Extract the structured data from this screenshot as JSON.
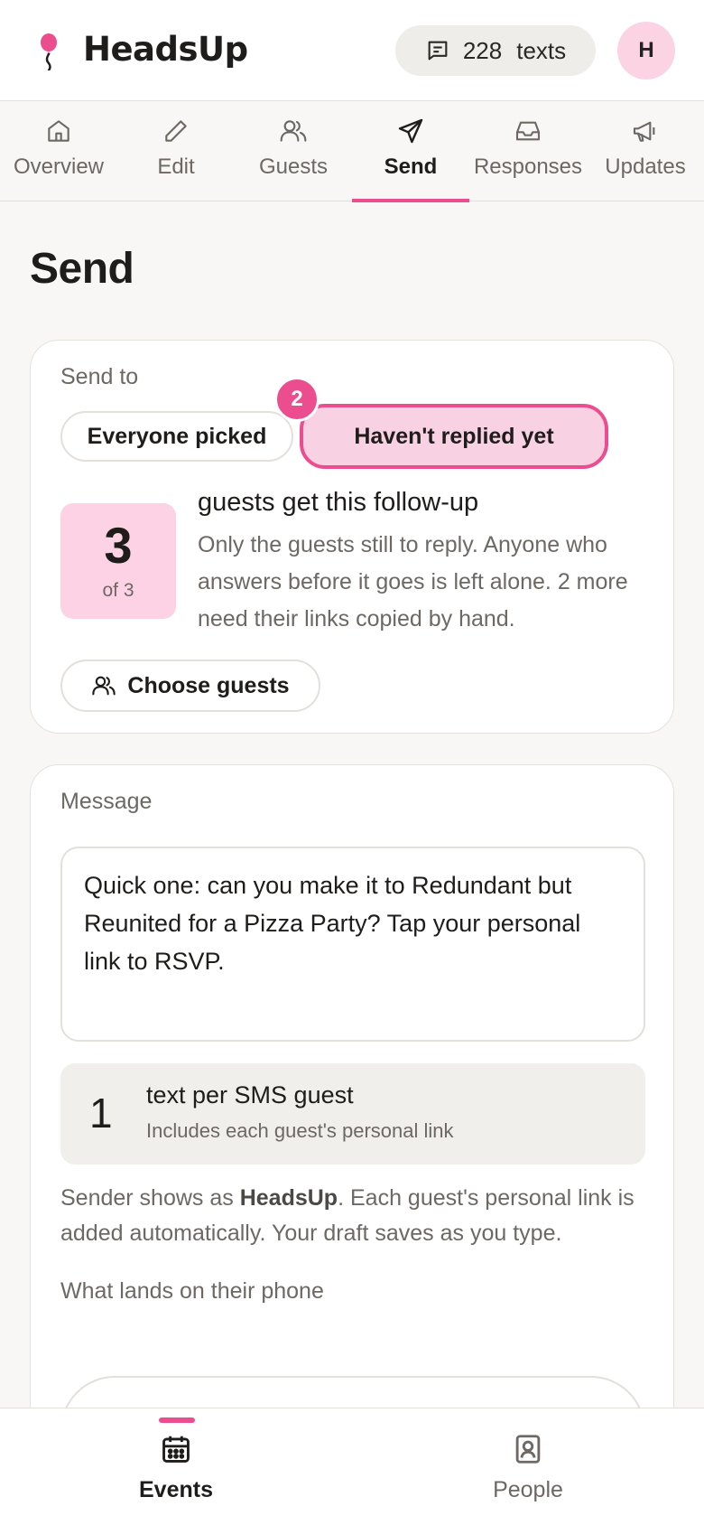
{
  "app": {
    "name": "HeadsUp",
    "texts_count": "228",
    "texts_label": "texts",
    "avatar_initial": "H",
    "accent_color": "#ec4d8e"
  },
  "tabs": [
    {
      "label": "Overview",
      "icon": "home-icon"
    },
    {
      "label": "Edit",
      "icon": "pencil-icon"
    },
    {
      "label": "Guests",
      "icon": "users-icon"
    },
    {
      "label": "Send",
      "icon": "send-icon",
      "active": true
    },
    {
      "label": "Responses",
      "icon": "inbox-icon"
    },
    {
      "label": "Updates",
      "icon": "megaphone-icon"
    }
  ],
  "page": {
    "title": "Send"
  },
  "send_to": {
    "label": "Send to",
    "options": [
      "Everyone picked",
      "Haven't replied yet"
    ],
    "selected": "Haven't replied yet",
    "step_badge": "2",
    "count": "3",
    "count_of": "of 3",
    "headline": "guests get this follow-up",
    "description": "Only the guests still to reply. Anyone who answers before it goes is left alone. 2 more need their links copied by hand.",
    "choose_button": "Choose guests"
  },
  "message": {
    "label": "Message",
    "text": "Quick one: can you make it to Redundant but Reunited for a Pizza Party? Tap your personal link to RSVP.",
    "sms_count": "1",
    "sms_title": "text per SMS guest",
    "sms_subtitle": "Includes each guest's personal link",
    "sender_prefix": "Sender shows as ",
    "sender_name": "HeadsUp",
    "sender_suffix": ". Each guest's personal link is added automatically. Your draft saves as you type.",
    "phone_label": "What lands on their phone"
  },
  "bottom_nav": [
    {
      "label": "Events",
      "icon": "calendar-icon",
      "active": true
    },
    {
      "label": "People",
      "icon": "contact-book-icon"
    }
  ]
}
